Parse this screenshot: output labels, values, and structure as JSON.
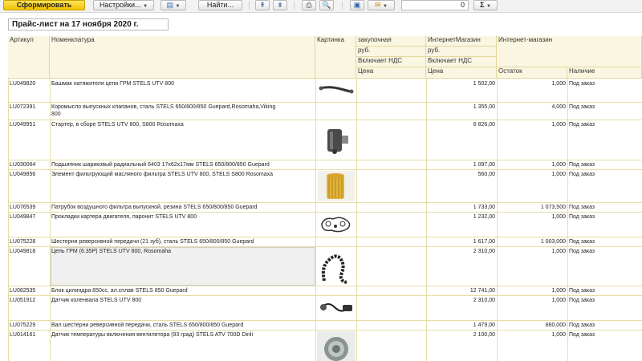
{
  "toolbar": {
    "generate_label": "Сформировать",
    "settings_label": "Настройки...",
    "find_label": "Найти...",
    "number_value": "0",
    "sum_symbol": "Σ"
  },
  "report": {
    "title": "Прайс-лист на 17 ноября 2020 г."
  },
  "headers": {
    "article": "Артикул",
    "nomenclature": "Номенклатура",
    "picture": "Картинка",
    "purchase": "закупочная",
    "purchase_currency": "руб.",
    "purchase_vat": "Включает НДС",
    "purchase_price": "Цена",
    "shop": "ИнтернетМагазин",
    "shop_currency": "руб.",
    "shop_vat": "Включает НДС",
    "shop_price": "Цена",
    "internet_shop": "Интернет-магазин",
    "stock": "Остаток",
    "availability": "Наличие"
  },
  "rows": [
    {
      "article": "LU049820",
      "name": "Башмак натяжителя цепи ГРМ STELS UTV 800",
      "name2": "",
      "price": "1 502,00",
      "stock": "1,000",
      "avail": "Под заказ"
    },
    {
      "article": "LU072391",
      "name": "Коромысло выпускных клапанов, сталь STELS 650/800/850 Guepard,Rosomaha,Viking",
      "name2": "800",
      "price": "1 355,00",
      "stock": "4,000",
      "avail": "Под заказ"
    },
    {
      "article": "LU049951",
      "name": "Стартер, в сборе STELS UTV 800, S800 Rosomaxa",
      "name2": "",
      "price": "6 826,00",
      "stock": "1,000",
      "avail": "Под заказ"
    },
    {
      "article": "LU030064",
      "name": "Подшипник шариковый радиальный 6403 17х62х17мм STELS 650/800/850 Guepard",
      "name2": "",
      "price": "1 097,00",
      "stock": "1,000",
      "avail": "Под заказ"
    },
    {
      "article": "LU049856",
      "name": "Элемент фильтрующий масляного фильтра STELS UTV 800, STELS S800 Rosomaxa",
      "name2": "",
      "price": "560,00",
      "stock": "1,000",
      "avail": "Под заказ"
    },
    {
      "article": "LU076539",
      "name": "Патрубок воздушного фильтра выпускной, резина STELS 650/800/850 Guepard",
      "name2": "",
      "price": "1 733,00",
      "stock": "1 073,500",
      "avail": "Под заказ"
    },
    {
      "article": "LU049847",
      "name": "Прокладки картера двигателя, паронит STELS UTV 800",
      "name2": "",
      "price": "1 232,00",
      "stock": "1,000",
      "avail": "Под заказ"
    },
    {
      "article": "LU075228",
      "name": "Шестерня реверсивной передачи (21 зуб), сталь STELS 650/800/850 Guepard",
      "name2": "",
      "price": "1 617,00",
      "stock": "1 003,000",
      "avail": "Под заказ"
    },
    {
      "article": "LU049818",
      "name": "Цепь ГРМ (6.35Р) STELS UTV 800, Rosomaha",
      "name2": "",
      "price": "2 310,00",
      "stock": "1,000",
      "avail": "Под заказ"
    },
    {
      "article": "LU082535",
      "name": "Блок цилиндра  850cc, ал.сплав STELS 850 Guepard",
      "name2": "",
      "price": "12 741,00",
      "stock": "1,000",
      "avail": "Под заказ"
    },
    {
      "article": "LU051912",
      "name": "Датчик коленвала STELS UTV 800",
      "name2": "",
      "price": "2 310,00",
      "stock": "1,000",
      "avail": "Под заказ"
    },
    {
      "article": "LU075229",
      "name": "Вал шестерни реверсивной передачи, сталь STELS 650/800/850 Guepard",
      "name2": "",
      "price": "1 479,00",
      "stock": "860,000",
      "avail": "Под заказ"
    },
    {
      "article": "LU014161",
      "name": "Датчик температуры включения вентилятора (93 град) STELS ATV 700D Dinli",
      "name2": "",
      "price": "2 100,00",
      "stock": "1,000",
      "avail": "Под заказ"
    }
  ],
  "colors": {
    "header_bg": "#fbf6e2",
    "grid_line": "#e6dda6",
    "primary_button": "#f2c200"
  }
}
